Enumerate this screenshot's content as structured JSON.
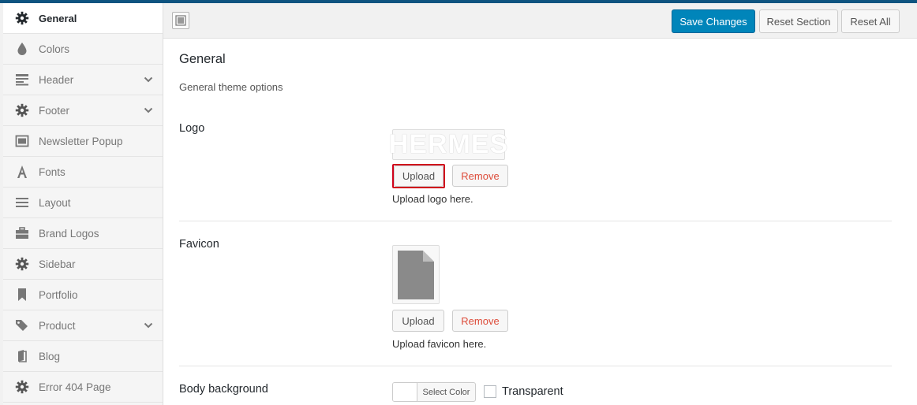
{
  "sidebar": {
    "items": [
      {
        "label": "General",
        "icon": "gear-icon",
        "active": true,
        "expandable": false
      },
      {
        "label": "Colors",
        "icon": "drop-icon",
        "active": false,
        "expandable": false
      },
      {
        "label": "Header",
        "icon": "header-icon",
        "active": false,
        "expandable": true
      },
      {
        "label": "Footer",
        "icon": "gear-icon",
        "active": false,
        "expandable": true
      },
      {
        "label": "Newsletter Popup",
        "icon": "window-icon",
        "active": false,
        "expandable": false
      },
      {
        "label": "Fonts",
        "icon": "font-icon",
        "active": false,
        "expandable": false
      },
      {
        "label": "Layout",
        "icon": "lines-icon",
        "active": false,
        "expandable": false
      },
      {
        "label": "Brand Logos",
        "icon": "briefcase-icon",
        "active": false,
        "expandable": false
      },
      {
        "label": "Sidebar",
        "icon": "gear-icon",
        "active": false,
        "expandable": false
      },
      {
        "label": "Portfolio",
        "icon": "bookmark-icon",
        "active": false,
        "expandable": false
      },
      {
        "label": "Product",
        "icon": "tags-icon",
        "active": false,
        "expandable": true
      },
      {
        "label": "Blog",
        "icon": "book-icon",
        "active": false,
        "expandable": false
      },
      {
        "label": "Error 404 Page",
        "icon": "gear-icon",
        "active": false,
        "expandable": false
      }
    ]
  },
  "toolbar": {
    "save_label": "Save Changes",
    "reset_section_label": "Reset Section",
    "reset_all_label": "Reset All"
  },
  "section": {
    "title": "General",
    "description": "General theme options"
  },
  "logo": {
    "label": "Logo",
    "image_text": "HERMES",
    "upload_label": "Upload",
    "remove_label": "Remove",
    "help": "Upload logo here."
  },
  "favicon": {
    "label": "Favicon",
    "upload_label": "Upload",
    "remove_label": "Remove",
    "help": "Upload favicon here."
  },
  "body_background": {
    "label": "Body background",
    "select_color_label": "Select Color",
    "transparent_label": "Transparent"
  },
  "colors": {
    "accent": "#0085ba",
    "top_bar": "#0e5480",
    "remove_text": "#dd4b39",
    "highlight": "#d0021b"
  }
}
